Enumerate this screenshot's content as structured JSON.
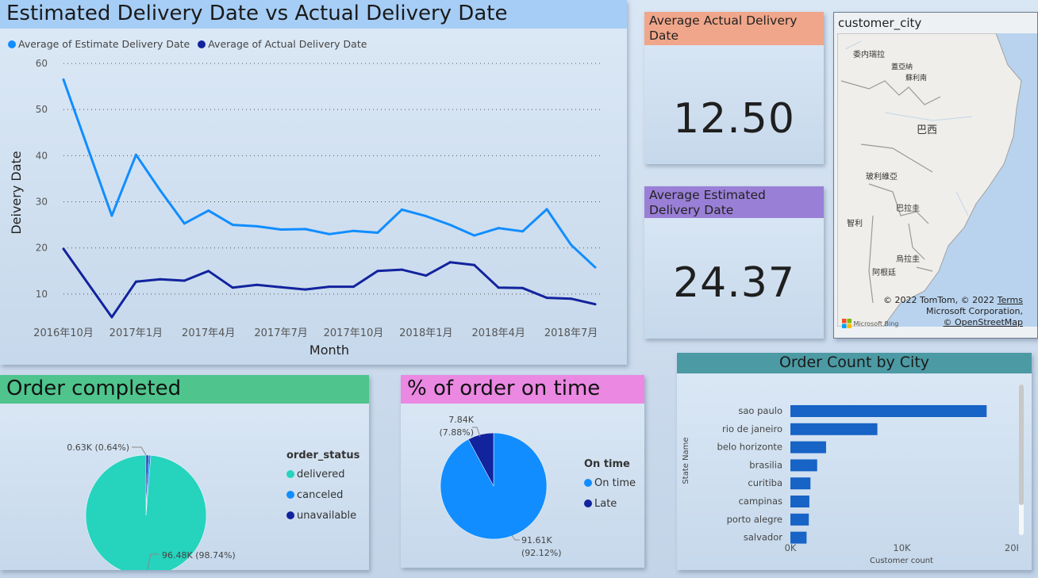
{
  "line_chart": {
    "title": "Estimated Delivery Date vs Actual Delivery Date",
    "legend": [
      "Average of Estimate Delivery Date",
      "Average of Actual Delivery Date"
    ]
  },
  "kpis": {
    "actual": {
      "label": "Average Actual Delivery Date",
      "value": "12.50",
      "color": "#f0a68a"
    },
    "estimated": {
      "label": "Average Estimated Delivery Date",
      "value": "24.37",
      "color": "#9a7fd6"
    }
  },
  "map": {
    "title": "customer_city",
    "labels": [
      "委内瑞拉",
      "蓋亞納",
      "蘇利南",
      "巴西",
      "玻利維亞",
      "巴拉圭",
      "智利",
      "烏拉圭",
      "阿根廷"
    ],
    "credit_line1": "© 2022 TomTom, © 2022",
    "credit_terms": "Terms",
    "credit_line2": "Microsoft Corporation,",
    "credit_osm": "© OpenStreetMap",
    "bing": "Microsoft Bing"
  },
  "chart_data": [
    {
      "type": "line",
      "title": "Estimated Delivery Date vs Actual Delivery Date",
      "xlabel": "Month",
      "ylabel": "Deivery Date",
      "ylim": [
        5,
        60
      ],
      "yticks": [
        10,
        20,
        30,
        40,
        50,
        60
      ],
      "x_tick_labels": [
        "2016年10月",
        "2017年1月",
        "2017年4月",
        "2017年7月",
        "2017年10月",
        "2018年1月",
        "2018年4月",
        "2018年7月"
      ],
      "x": [
        "2016-10",
        "2016-12",
        "2017-01",
        "2017-02",
        "2017-03",
        "2017-04",
        "2017-05",
        "2017-06",
        "2017-07",
        "2017-08",
        "2017-09",
        "2017-10",
        "2017-11",
        "2017-12",
        "2018-01",
        "2018-02",
        "2018-03",
        "2018-04",
        "2018-05",
        "2018-06",
        "2018-07",
        "2018-08"
      ],
      "series": [
        {
          "name": "Average of Estimate Delivery Date",
          "color": "#118dff",
          "values": [
            56.5,
            27,
            40.2,
            32.5,
            25.3,
            28.1,
            25,
            24.7,
            24,
            24.1,
            23,
            23.7,
            23.3,
            28.3,
            26.9,
            25,
            22.7,
            24.3,
            23.6,
            28.4,
            20.7,
            15.8
          ]
        },
        {
          "name": "Average of Actual Delivery Date",
          "color": "#12239e",
          "values": [
            19.8,
            5,
            12.7,
            13.2,
            12.9,
            15,
            11.4,
            12,
            11.5,
            11,
            11.6,
            11.6,
            15,
            15.3,
            14,
            16.9,
            16.3,
            11.4,
            11.3,
            9.2,
            9,
            7.8
          ]
        }
      ],
      "grid": "horizontal dotted",
      "legend_position": "top-left"
    },
    {
      "type": "pie",
      "title": "Order completed",
      "legend_title": "order_status",
      "slices": [
        {
          "label": "delivered",
          "value": 96480,
          "display": "96.48K (98.74%)",
          "color": "#26d3bd"
        },
        {
          "label": "canceled",
          "value": 610,
          "display": "",
          "color": "#118dff"
        },
        {
          "label": "unavailable",
          "value": 630,
          "display": "0.63K (0.64%)",
          "color": "#12239e"
        }
      ]
    },
    {
      "type": "pie",
      "title": "% of order on time",
      "legend_title": "On time",
      "slices": [
        {
          "label": "On time",
          "value": 91610,
          "display_value": "91.61K",
          "display_pct": "(92.12%)",
          "color": "#118dff"
        },
        {
          "label": "Late",
          "value": 7840,
          "display_value": "7.84K",
          "display_pct": "(7.88%)",
          "color": "#12239e"
        }
      ]
    },
    {
      "type": "bar",
      "orientation": "horizontal",
      "title": "Order Count by City",
      "xlabel": "Customer count",
      "ylabel": "State Name",
      "categories": [
        "sao paulo",
        "rio de janeiro",
        "belo horizonte",
        "brasilia",
        "curitiba",
        "campinas",
        "porto alegre",
        "salvador"
      ],
      "values": [
        17600,
        7800,
        3200,
        2400,
        1800,
        1700,
        1650,
        1450
      ],
      "xlim": [
        0,
        20000
      ],
      "xticks": [
        0,
        10000,
        20000
      ],
      "xtick_labels": [
        "0K",
        "10K",
        "20K"
      ],
      "color": "#1763c6"
    }
  ]
}
